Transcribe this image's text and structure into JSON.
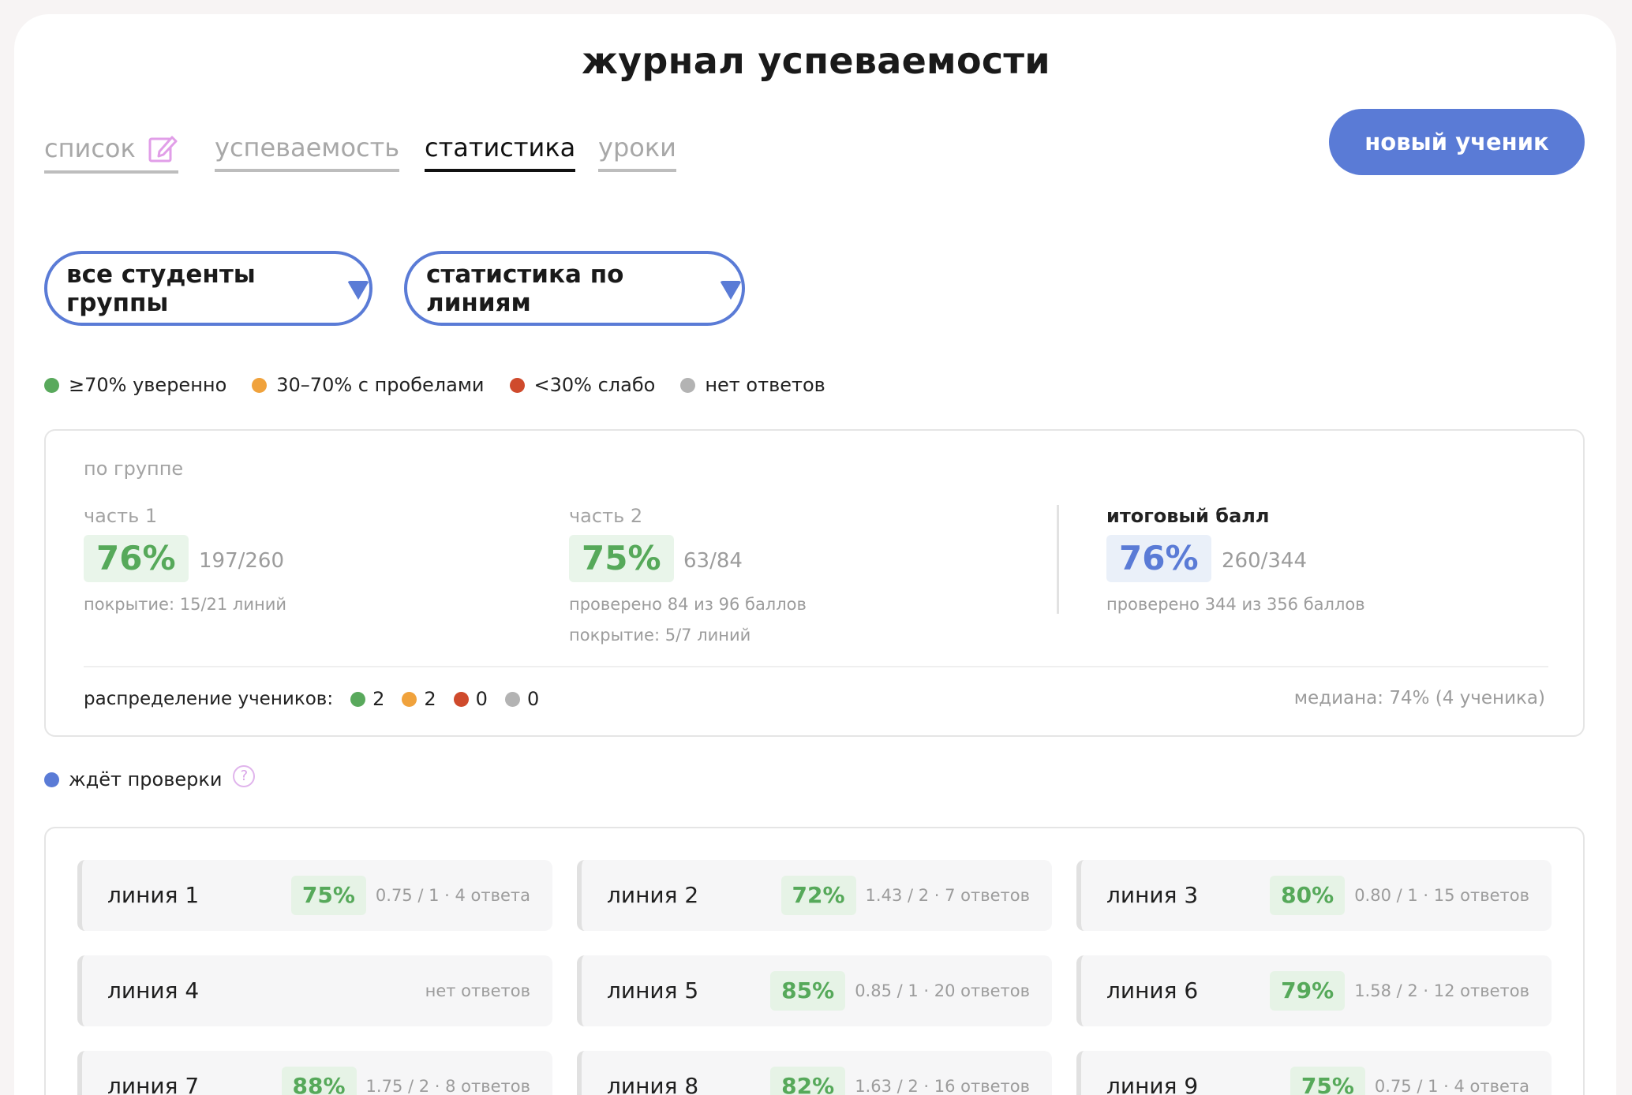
{
  "title": "журнал успеваемости",
  "tabs": [
    {
      "label": "список",
      "active": false,
      "icon": "edit-icon"
    },
    {
      "label": "успеваемость",
      "active": false
    },
    {
      "label": "статистика",
      "active": true
    },
    {
      "label": "уроки",
      "active": false
    }
  ],
  "new_student_button": "новый ученик",
  "filters": {
    "students": "все студенты группы",
    "mode": "статистика по линиям"
  },
  "legend": [
    {
      "color": "#59a95c",
      "label": "≥70% уверенно"
    },
    {
      "color": "#f0a23c",
      "label": "30–70% с пробелами"
    },
    {
      "color": "#cf4a2c",
      "label": "<30% слабо"
    },
    {
      "color": "#b3b3b3",
      "label": "нет ответов"
    }
  ],
  "summary": {
    "heading": "по группе",
    "part1": {
      "label": "часть 1",
      "percent": "76%",
      "fraction": "197/260",
      "coverage": "покрытие: 15/21 линий"
    },
    "part2": {
      "label": "часть 2",
      "percent": "75%",
      "fraction": "63/84",
      "checked": "проверено 84 из 96 баллов",
      "coverage": "покрытие: 5/7 линий"
    },
    "total": {
      "label": "итоговый балл",
      "percent": "76%",
      "fraction": "260/344",
      "checked": "проверено 344 из 356 баллов"
    },
    "distribution": {
      "label": "распределение учеников:",
      "green": "2",
      "orange": "2",
      "red": "0",
      "gray": "0"
    },
    "median": "медиана: 74% (4 ученика)"
  },
  "pending": {
    "label": "ждёт проверки",
    "help_icon": "question-icon",
    "color": "#5a7bd6"
  },
  "lines": [
    {
      "name": "линия 1",
      "percent": "75%",
      "meta": "0.75 / 1 · 4 ответа"
    },
    {
      "name": "линия 2",
      "percent": "72%",
      "meta": "1.43 / 2 · 7 ответов"
    },
    {
      "name": "линия 3",
      "percent": "80%",
      "meta": "0.80 / 1 · 15 ответов"
    },
    {
      "name": "линия 4",
      "percent": "",
      "meta": "нет ответов"
    },
    {
      "name": "линия 5",
      "percent": "85%",
      "meta": "0.85 / 1 · 20 ответов"
    },
    {
      "name": "линия 6",
      "percent": "79%",
      "meta": "1.58 / 2 · 12 ответов"
    },
    {
      "name": "линия 7",
      "percent": "88%",
      "meta": "1.75 / 2 · 8 ответов"
    },
    {
      "name": "линия 8",
      "percent": "82%",
      "meta": "1.63 / 2 · 16 ответов"
    },
    {
      "name": "линия 9",
      "percent": "75%",
      "meta": "0.75 / 1 · 4 ответа"
    }
  ]
}
